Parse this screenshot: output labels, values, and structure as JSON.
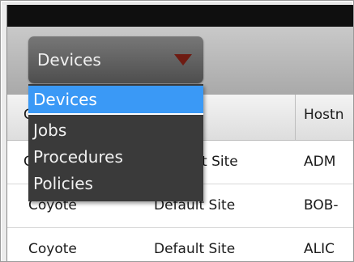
{
  "toolbar": {
    "dropdown": {
      "selected_label": "Devices",
      "options": [
        "Devices",
        "Jobs",
        "Procedures",
        "Policies"
      ]
    }
  },
  "table": {
    "columns": [
      "C",
      "",
      "Hostn"
    ],
    "rows": [
      {
        "col1": "C",
        "col2": "t Site",
        "col3": "ADM"
      },
      {
        "col1": "Coyote",
        "col2": "Default Site",
        "col3": "BOB-"
      },
      {
        "col1": "Coyote",
        "col2": "Default Site",
        "col3": "ALIC"
      }
    ]
  },
  "colors": {
    "menu_bg": "#3a3a3a",
    "selected_item": "#3a99f6",
    "arrow": "#6e1b12",
    "title_bar": "#0f0f0f"
  }
}
